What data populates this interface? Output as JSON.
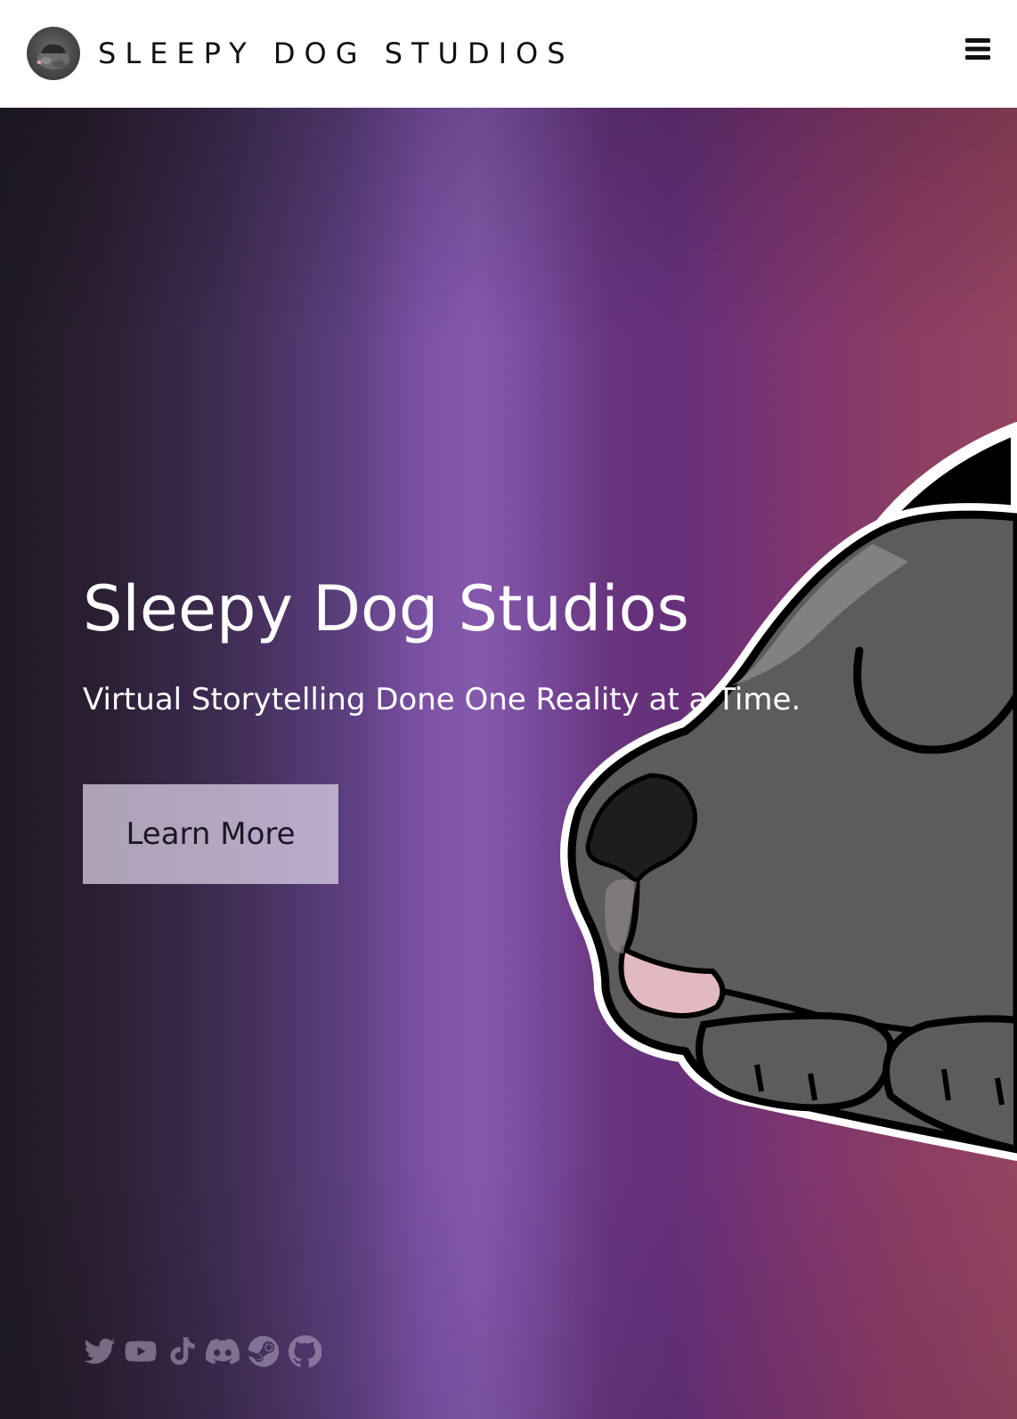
{
  "navbar": {
    "brand_text": "SLEEPY DOG STUDIOS",
    "logo_icon": "sleepy-dog-logo",
    "menu_icon": "hamburger-menu-icon"
  },
  "hero": {
    "title": "Sleepy Dog Studios",
    "subtitle": "Virtual Storytelling Done One Reality at a Time.",
    "cta_label": "Learn More",
    "illustration": "sleeping-dog-illustration"
  },
  "social": {
    "links": [
      {
        "icon": "twitter-icon"
      },
      {
        "icon": "youtube-icon"
      },
      {
        "icon": "tiktok-icon"
      },
      {
        "icon": "discord-icon"
      },
      {
        "icon": "steam-icon"
      },
      {
        "icon": "github-icon"
      }
    ]
  },
  "colors": {
    "navbar_background": "#ffffff",
    "hero_gradient": [
      "#1f1a24",
      "#8559ab",
      "#65307a",
      "#944461"
    ],
    "button_background": "#d9cfe3",
    "text_light": "#ffffff",
    "social_icon": "#b8a9c6"
  }
}
